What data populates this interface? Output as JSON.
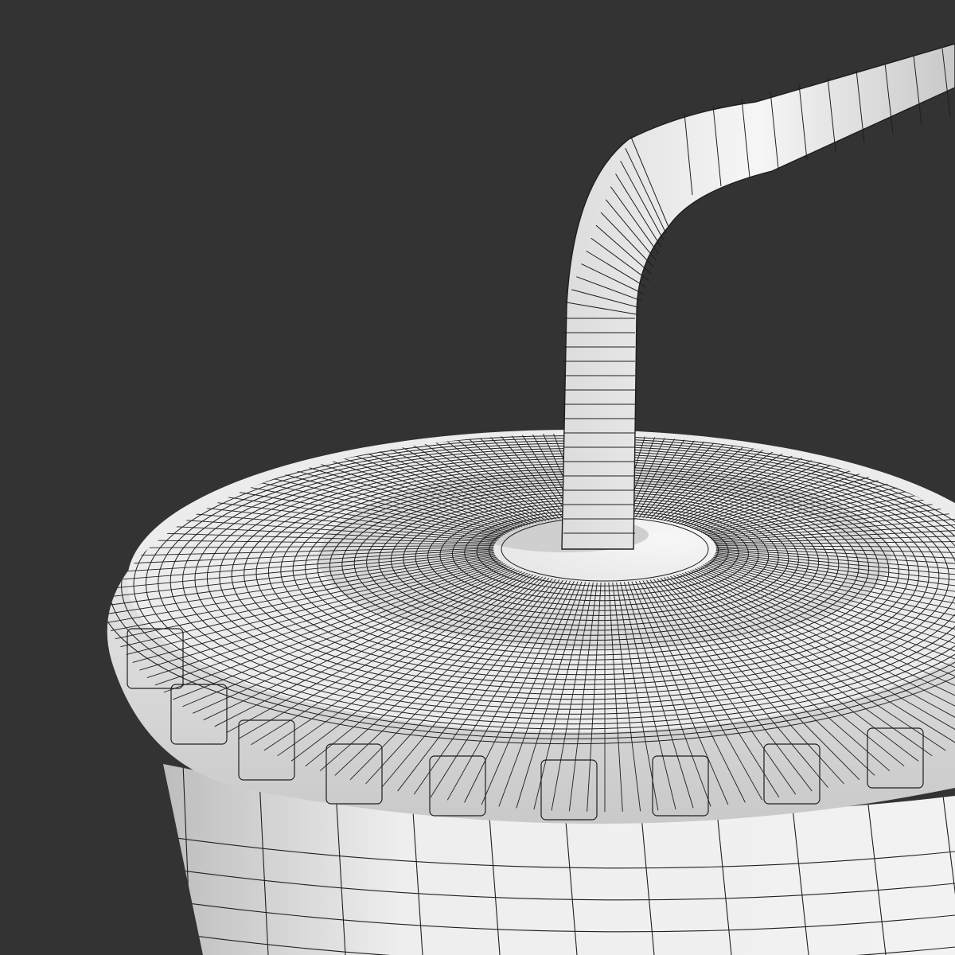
{
  "scene": {
    "background_color": "#333333",
    "model_color": "#e6e6e6",
    "wire_color": "#1e1e1e",
    "objects": [
      "cup-body",
      "cup-lid",
      "bendy-straw"
    ]
  }
}
